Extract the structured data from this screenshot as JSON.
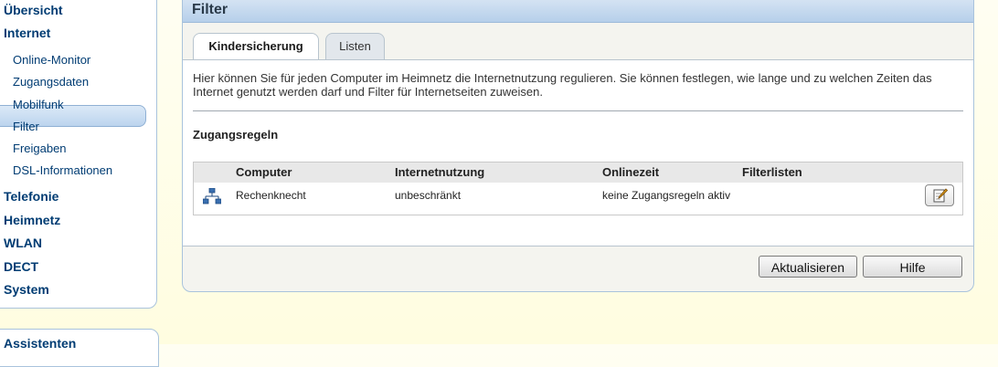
{
  "sidebar": {
    "items": [
      {
        "label": "Übersicht"
      },
      {
        "label": "Internet"
      },
      {
        "label": "Online-Monitor"
      },
      {
        "label": "Zugangsdaten"
      },
      {
        "label": "Mobilfunk"
      },
      {
        "label": "Filter"
      },
      {
        "label": "Freigaben"
      },
      {
        "label": "DSL-Informationen"
      },
      {
        "label": "Telefonie"
      },
      {
        "label": "Heimnetz"
      },
      {
        "label": "WLAN"
      },
      {
        "label": "DECT"
      },
      {
        "label": "System"
      }
    ],
    "assistant_label": "Assistenten"
  },
  "panel": {
    "title": "Filter",
    "tabs": [
      {
        "label": "Kindersicherung"
      },
      {
        "label": "Listen"
      }
    ],
    "intro": "Hier können Sie für jeden Computer im Heimnetz die Internetnutzung regulieren. Sie können festlegen, wie lange und zu welchen Zeiten das Internet genutzt werden darf und Filter für Internetseiten zuweisen.",
    "section_title": "Zugangsregeln",
    "table": {
      "headers": [
        "Computer",
        "Internetnutzung",
        "Onlinezeit",
        "Filterlisten"
      ],
      "rows": [
        {
          "computer": "Rechenknecht",
          "usage": "unbeschränkt",
          "online_time": "keine Zugangsregeln aktiv",
          "filter_lists": ""
        }
      ]
    },
    "buttons": {
      "refresh": "Aktualisieren",
      "help": "Hilfe"
    }
  },
  "colors": {
    "nav_text": "#003c73",
    "panel_border": "#a9c3dc",
    "active_nav": "#bcd4ee"
  }
}
